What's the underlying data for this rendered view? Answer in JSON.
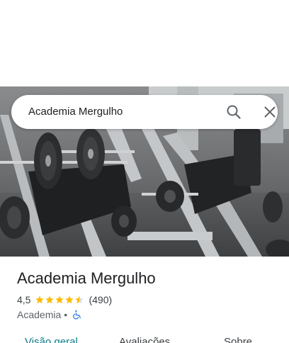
{
  "search": {
    "query": "Academia Mergulho",
    "search_icon": "search-icon",
    "close_icon": "close-icon"
  },
  "photo": {
    "subject": "gym-equipment-photo"
  },
  "place": {
    "title": "Academia Mergulho",
    "rating": "4,5",
    "stars": 4.5,
    "reviews": "(490)",
    "category": "Academia",
    "separator": "•",
    "accessibility_icon": "wheelchair-icon"
  },
  "tabs": [
    {
      "label": "Visão geral",
      "active": true
    },
    {
      "label": "Avaliações",
      "active": false
    },
    {
      "label": "Sobre",
      "active": false
    }
  ],
  "colors": {
    "star": "#fbbc04",
    "active_tab": "#0b7a8a",
    "accessibility": "#1a73e8"
  }
}
